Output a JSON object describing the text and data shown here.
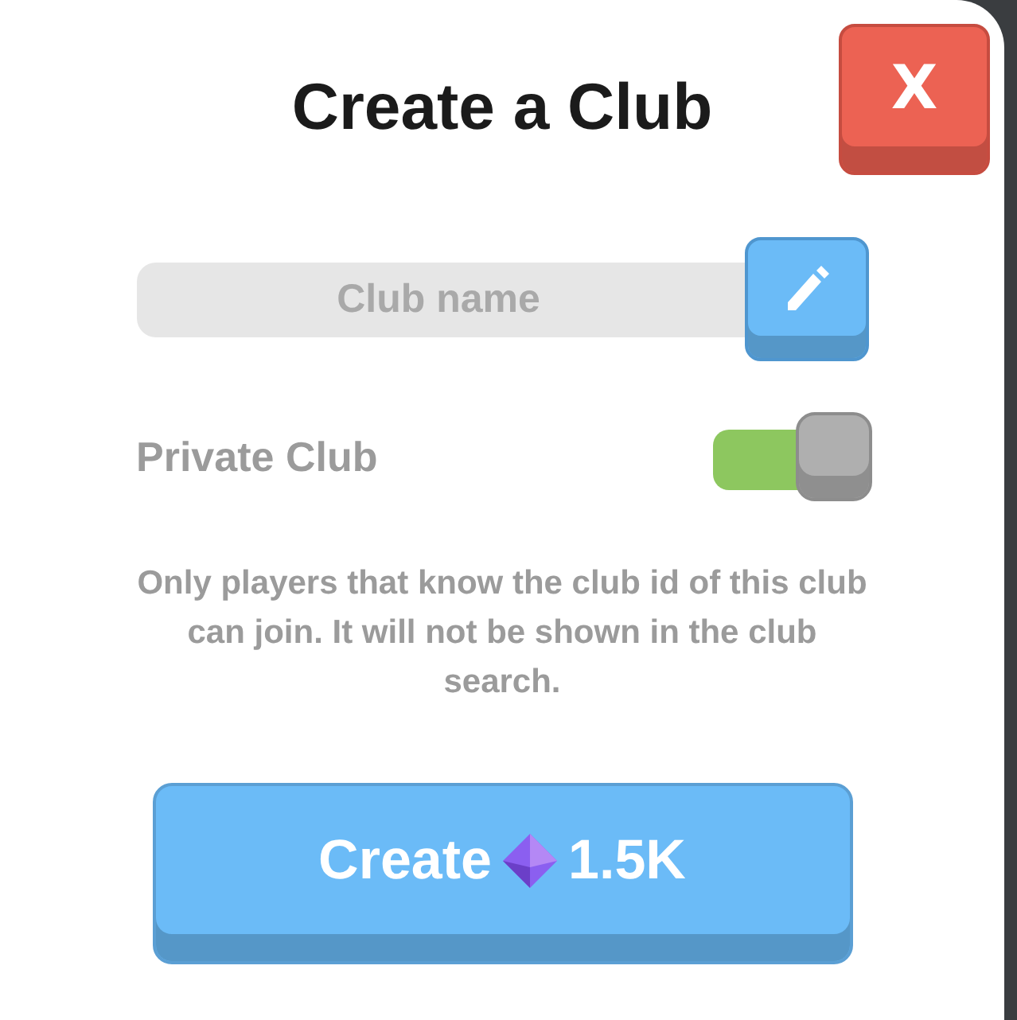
{
  "dialog": {
    "title": "Create a Club",
    "close_button": {
      "label": "X"
    }
  },
  "name_field": {
    "placeholder": "Club name"
  },
  "private_toggle": {
    "label": "Private Club",
    "on": true
  },
  "description": "Only players that know the club id of this club can join. It will not be shown in the club search.",
  "create_button": {
    "label": "Create",
    "price": "1.5K"
  }
}
